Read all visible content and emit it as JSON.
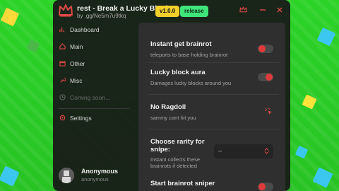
{
  "window": {
    "title": "rest - Break a Lucky Block!",
    "subtitle": "by .gg/Ne5m7u9tkq",
    "version_badge": "v1.0.0",
    "release_badge": "release",
    "accent_color": "#e04848"
  },
  "sidebar": {
    "items": [
      {
        "label": "Dashboard",
        "icon": "bar-chart-icon"
      },
      {
        "label": "Main",
        "icon": "house-icon"
      },
      {
        "label": "Other",
        "icon": "box-icon"
      },
      {
        "label": "Misc",
        "icon": "wrench-icon"
      },
      {
        "label": "Coming soon...",
        "icon": "clock-icon",
        "disabled": true
      },
      {
        "label": "Settings",
        "icon": "gear-icon"
      }
    ]
  },
  "user": {
    "name": "Anonymous",
    "handle": "anonymous"
  },
  "options": [
    {
      "title": "Instant get brainrot",
      "desc": "teleports to base holding brainrot",
      "control": "toggle",
      "state": "off"
    },
    {
      "title": "Lucky block aura",
      "desc": "Damages lucky blocks around you",
      "control": "toggle",
      "state": "on"
    },
    {
      "title": "No Ragdoll",
      "desc": "sammy cant hit you",
      "control": "icon"
    },
    {
      "title": "Choose rarity for snipe:",
      "desc": "Instant collects these brainrots if detected",
      "control": "dropdown",
      "value": "--"
    },
    {
      "title": "Start brainrot sniper",
      "desc": "",
      "control": "toggle",
      "state": "off"
    }
  ]
}
